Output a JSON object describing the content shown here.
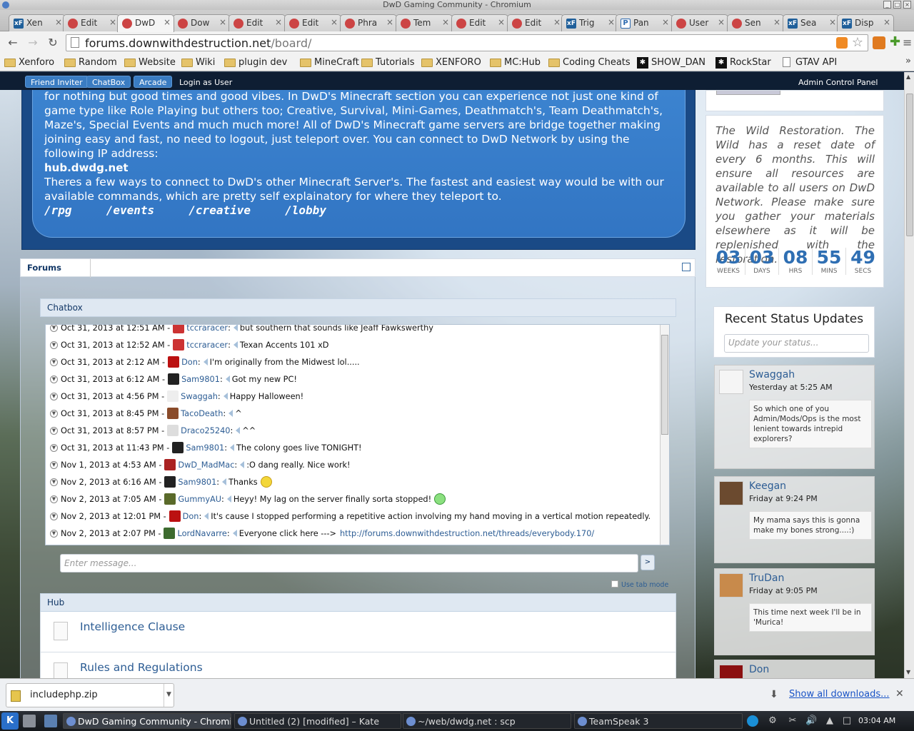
{
  "window": {
    "title": "DwD Gaming Community - Chromium"
  },
  "tabs": [
    {
      "label": "Xen",
      "icon": "xf"
    },
    {
      "label": "Edit",
      "icon": "bio"
    },
    {
      "label": "DwD",
      "icon": "bio",
      "active": true
    },
    {
      "label": "Dow",
      "icon": "bio"
    },
    {
      "label": "Edit",
      "icon": "bio"
    },
    {
      "label": "Edit",
      "icon": "bio"
    },
    {
      "label": "Phra",
      "icon": "bio"
    },
    {
      "label": "Tem",
      "icon": "bio"
    },
    {
      "label": "Edit",
      "icon": "bio"
    },
    {
      "label": "Edit",
      "icon": "bio"
    },
    {
      "label": "Trig",
      "icon": "xf"
    },
    {
      "label": "Pan",
      "icon": "p"
    },
    {
      "label": "User",
      "icon": "bio"
    },
    {
      "label": "Sen",
      "icon": "bio"
    },
    {
      "label": "Sea",
      "icon": "xf"
    },
    {
      "label": "Disp",
      "icon": "xf"
    }
  ],
  "address": {
    "host": "forums.downwithdestruction.net",
    "path": "/board/"
  },
  "bookmarks": [
    {
      "label": "Xenforo",
      "icon": "folder"
    },
    {
      "label": "Random",
      "icon": "folder"
    },
    {
      "label": "Website",
      "icon": "folder"
    },
    {
      "label": "Wiki",
      "icon": "folder"
    },
    {
      "label": "plugin dev",
      "icon": "folder"
    },
    {
      "label": "MineCraft",
      "icon": "folder"
    },
    {
      "label": "Tutorials",
      "icon": "folder"
    },
    {
      "label": "XENFORO",
      "icon": "folder"
    },
    {
      "label": "MC:Hub",
      "icon": "folder"
    },
    {
      "label": "Coding Cheats",
      "icon": "folder"
    },
    {
      "label": "SHOW_DAN",
      "icon": "dark"
    },
    {
      "label": "RockStar",
      "icon": "dark"
    },
    {
      "label": "GTAV API",
      "icon": "doc"
    }
  ],
  "adminbar": {
    "buttons": [
      "Friend Inviter",
      "ChatBox",
      "Arcade"
    ],
    "login_as": "Login as User",
    "admin_cp": "Admin Control Panel"
  },
  "hero": {
    "para1": "for nothing but good times and good vibes. In DwD's Minecraft section you can experience not just one kind of game type like Role Playing but others too; Creative, Survival, Mini-Games, Deathmatch's, Team Deathmatch's, Maze's, Special Events and much much more! All of DwD's Minecraft game servers are bridge together making joining easy and fast, no need to logout, just teleport over. You can connect to DwD Network by using the following IP address:",
    "ip": "hub.dwdg.net",
    "para2": "Theres a few ways to connect to DwD's other Minecraft Server's. The fastest and easiest way would be with our available commands, which are pretty self explainatory for where they teleport to.",
    "commands": "/rpg     /events     /creative     /lobby"
  },
  "countdown": {
    "message": "The Wild Restoration. The Wild has a reset date of every 6 months. This will ensure all resources are available to all users on DwD Network. Please make sure you gather your materials elsewhere as it will be replenished with the restoration.",
    "units": [
      {
        "value": "03",
        "label": "WEEKS"
      },
      {
        "value": "03",
        "label": "DAYS"
      },
      {
        "value": "08",
        "label": "HRS"
      },
      {
        "value": "55",
        "label": "MINS"
      },
      {
        "value": "49",
        "label": "SECS"
      }
    ]
  },
  "status_updates": {
    "title": "Recent Status Updates",
    "placeholder": "Update your status...",
    "items": [
      {
        "user": "Swaggah",
        "time": "Yesterday at 5:25 AM",
        "text": "So which one of you Admin/Mods/Ops is the most lenient towards intrepid explorers?"
      },
      {
        "user": "Keegan",
        "time": "Friday at 9:24 PM",
        "text": "My mama says this is gonna make my bones strong....:)"
      },
      {
        "user": "TruDan",
        "time": "Friday at 9:05 PM",
        "text": "This time next week I'll be in 'Murica!"
      },
      {
        "user": "Don",
        "time": "",
        "text": ""
      }
    ]
  },
  "breadcrumb": {
    "label": "Forums"
  },
  "chatbox": {
    "title": "Chatbox",
    "messages": [
      {
        "time": "Oct 31, 2013 at 12:51 AM -",
        "user": "tccraracer",
        "text": "but southern that sounds like Jeaff Fawkswerthy",
        "avatar": "#c33"
      },
      {
        "time": "Oct 31, 2013 at 12:52 AM -",
        "user": "tccraracer",
        "text": "Texan Accents 101 xD",
        "avatar": "#c33"
      },
      {
        "time": "Oct 31, 2013 at 2:12 AM -",
        "user": "Don",
        "text": "I'm originally from the Midwest lol.....",
        "avatar": "#b11"
      },
      {
        "time": "Oct 31, 2013 at 6:12 AM -",
        "user": "Sam9801",
        "text": "Got my new PC!",
        "avatar": "#222"
      },
      {
        "time": "Oct 31, 2013 at 4:56 PM -",
        "user": "Swaggah",
        "text": "Happy Halloween!",
        "avatar": "#eee"
      },
      {
        "time": "Oct 31, 2013 at 8:45 PM -",
        "user": "TacoDeath",
        "text": "^",
        "avatar": "#8a4b2a"
      },
      {
        "time": "Oct 31, 2013 at 8:57 PM -",
        "user": "Draco25240",
        "text": "^^",
        "avatar": "#ddd"
      },
      {
        "time": "Oct 31, 2013 at 11:43 PM -",
        "user": "Sam9801",
        "text": "The colony goes live TONIGHT!",
        "avatar": "#222"
      },
      {
        "time": "Nov 1, 2013 at 4:53 AM -",
        "user": "DwD_MadMac",
        "text": ":O dang really. Nice work!",
        "avatar": "#a22"
      },
      {
        "time": "Nov 2, 2013 at 6:16 AM -",
        "user": "Sam9801",
        "text": "Thanks",
        "avatar": "#222",
        "emoji": "yellow"
      },
      {
        "time": "Nov 2, 2013 at 7:05 AM -",
        "user": "GummyAU",
        "text": "Heyy! My lag on the server finally sorta stopped!",
        "avatar": "#5a6a2a",
        "emoji": "green"
      },
      {
        "time": "Nov 2, 2013 at 12:01 PM -",
        "user": "Don",
        "text": "It's cause I stopped performing a repetitive action involving my hand moving in a vertical motion repeatedly.",
        "avatar": "#b11"
      },
      {
        "time": "Nov 2, 2013 at 2:07 PM -",
        "user": "LordNavarre",
        "text": "Everyone click here --->",
        "avatar": "#3d6b2f",
        "link": "http://forums.downwithdestruction.net/threads/everybody.170/"
      }
    ],
    "input_placeholder": "Enter message...",
    "send_label": ">",
    "tab_mode": "Use tab mode"
  },
  "hub": {
    "title": "Hub",
    "nodes": [
      "Intelligence Clause",
      "Rules and Regulations"
    ]
  },
  "downloads": {
    "file": "includephp.zip",
    "show_all": "Show all downloads..."
  },
  "taskbar": {
    "tasks": [
      {
        "label": "DwD Gaming Community - Chromium",
        "active": true
      },
      {
        "label": "Untitled (2) [modified] – Kate"
      },
      {
        "label": "~/web/dwdg.net : scp"
      },
      {
        "label": "TeamSpeak 3"
      }
    ],
    "clock": "03:04 AM"
  }
}
